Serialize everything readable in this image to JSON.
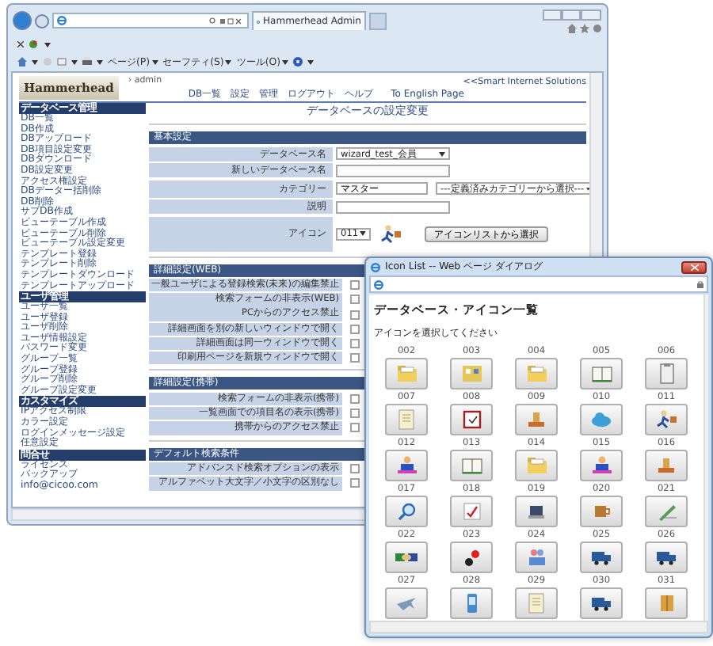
{
  "browser": {
    "tab_title": "Hammerhead Admin",
    "menus": [
      "ページ(P)",
      "セーフティ(S)",
      "ツール(O)"
    ]
  },
  "header": {
    "logo": "Hammerhead",
    "user": "› admin",
    "nav": [
      "DB一覧",
      "設定",
      "管理",
      "ログアウト",
      "ヘルプ"
    ],
    "english_link": "To English Page",
    "tagline": "<<Smart Internet Solutions"
  },
  "sidebar": [
    {
      "title": "データベース管理",
      "items": [
        "DB一覧",
        "DB作成",
        "DBアップロード",
        "DB項目設定変更",
        "DBダウンロード",
        "DB設定変更",
        "アクセス権設定",
        "DBデーター括削除",
        "DB削除",
        "サブDB作成",
        "ビューテーブル作成",
        "ビューテーブル削除",
        "ビューテーブル設定変更",
        "テンプレート登録",
        "テンプレート削除",
        "テンプレートダウンロード",
        "テンプレートアップロード"
      ]
    },
    {
      "title": "ユーザ管理",
      "items": [
        "ユーザ一覧",
        "ユーザ登録",
        "ユーザ削除",
        "ユーザ情報設定",
        "パスワード変更",
        "グループ一覧",
        "グループ登録",
        "グループ削除",
        "グループ設定変更"
      ]
    },
    {
      "title": "カスタマイズ",
      "items": [
        "IPアクセス制限",
        "カラー設定",
        "ログインメッセージ設定",
        "任意設定"
      ]
    },
    {
      "title": "問合せ",
      "items": [
        "ライセンス",
        "バックアップ",
        "info@cicoo.com"
      ]
    }
  ],
  "page_title": "データベースの設定変更",
  "basic": {
    "title": "基本設定",
    "fields": [
      {
        "kind": "select",
        "label": "データベース名",
        "value": "wizard_test_会員"
      },
      {
        "kind": "input",
        "label": "新しいデータベース名"
      },
      {
        "kind": "input_select",
        "label": "カテゴリー",
        "value": "マスター",
        "option": "---定義済みカテゴリーから選択---"
      },
      {
        "kind": "input",
        "label": "説明"
      },
      {
        "kind": "icon",
        "label": "アイコン",
        "value": "011",
        "button": "アイコンリストから選択"
      }
    ]
  },
  "sections": [
    {
      "title": "詳細設定(WEB)",
      "options": [
        {
          "label": "一般ユーザによる登録検索(未来)の編集禁止",
          "checked": false
        },
        {
          "label": "検索フォームの非表示(WEB)",
          "checked": false
        },
        {
          "label": "PCからのアクセス禁止",
          "checked": false
        },
        {
          "label": "詳細画面を別の新しいウィンドウで開く",
          "checked": false
        },
        {
          "label": "詳細画面は同一ウィンドウで開く",
          "checked": false
        },
        {
          "label": "印刷用ページを新規ウィンドウで開く",
          "checked": false
        }
      ]
    },
    {
      "title": "詳細設定(携帯)",
      "options": [
        {
          "label": "検索フォームの非表示(携帯)",
          "checked": false
        },
        {
          "label": "一覧画面での項目名の表示(携帯)",
          "checked": false
        },
        {
          "label": "携帯からのアクセス禁止",
          "checked": false
        }
      ]
    },
    {
      "title": "デフォルト検索条件",
      "options": [
        {
          "label": "アドバンスド検索オプションの表示",
          "checked": false
        },
        {
          "label": "アルファベット大文字／小文字の区別なし",
          "checked": false
        }
      ]
    }
  ],
  "dialog": {
    "title": "Icon List -- Web ページ ダイアログ",
    "heading": "データベース・アイコン一覧",
    "prompt": "アイコンを選択してください",
    "icons": [
      "002",
      "003",
      "004",
      "005",
      "006",
      "007",
      "008",
      "009",
      "010",
      "011",
      "012",
      "013",
      "014",
      "015",
      "016",
      "017",
      "018",
      "019",
      "020",
      "021",
      "022",
      "023",
      "024",
      "025",
      "026",
      "027",
      "028",
      "029",
      "030",
      "031"
    ]
  }
}
